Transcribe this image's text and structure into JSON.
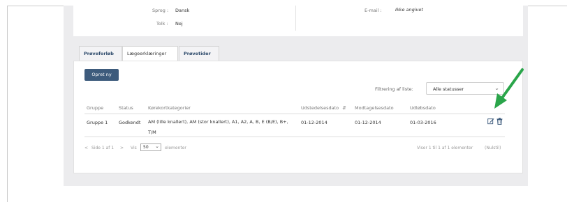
{
  "profile": {
    "language_label": "Sprog :",
    "language_value": "Dansk",
    "interpreter_label": "Tolk :",
    "interpreter_value": "Nej",
    "email_label": "E-mail :",
    "email_value": "Ikke angivet"
  },
  "tabs": [
    {
      "label": "Prøveforløb",
      "active": false
    },
    {
      "label": "Lægeerklæringer",
      "active": true
    },
    {
      "label": "Prøvetider",
      "active": false
    }
  ],
  "toolbar": {
    "create_label": "Opret ny",
    "filter_label": "Filtrering af liste:",
    "filter_value": "Alle statusser"
  },
  "table": {
    "headers": [
      "Gruppe",
      "Status",
      "Kørekortkategorier",
      "Udstedelsesdato",
      "Modtagelsesdato",
      "Udløbsdato"
    ],
    "rows": [
      {
        "gruppe": "Gruppe 1",
        "status": "Godkendt",
        "kategorier": "AM (lille knallert), AM (stor knallert), A1, A2, A, B, E (B/E), B+, T/M",
        "udstedelse": "01-12-2014",
        "modtagelse": "01-12-2014",
        "udloeb": "01-03-2016"
      }
    ]
  },
  "pager": {
    "page_info": "Side 1 af 1",
    "show_label": "Vis",
    "page_size": "50",
    "elements_label": "elementer",
    "summary": "Viser 1 til 1 af 1 elementer",
    "null_label": "(Nulstil)"
  },
  "colors": {
    "primary": "#3d5b7c",
    "arrow": "#2aa54a",
    "tab_text": "#2d4a6b"
  }
}
